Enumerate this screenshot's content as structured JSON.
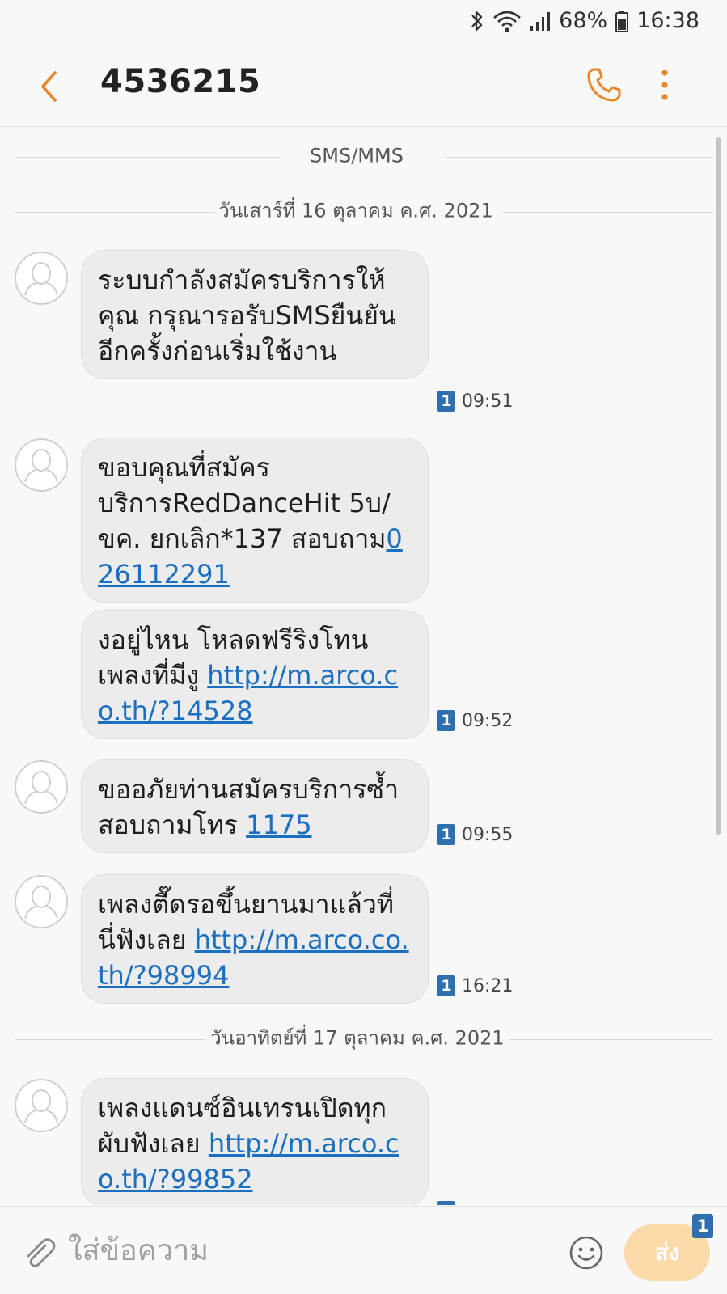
{
  "status_bar": {
    "battery": "68%",
    "time": "16:38",
    "icons": [
      "bluetooth-icon",
      "wifi-icon",
      "signal-icon",
      "battery-icon"
    ]
  },
  "header": {
    "title": "4536215",
    "back_icon": "chevron-left-icon",
    "call_icon": "phone-icon",
    "more_icon": "more-vertical-icon",
    "accent_color": "#e8862a"
  },
  "conversation": {
    "channel_label": "SMS/MMS",
    "date_1": "วันเสาร์ที่ 16 ตุลาคม ค.ศ. 2021",
    "date_2": "วันอาทิตย์ที่ 17 ตุลาคม ค.ศ. 2021",
    "messages": [
      {
        "text": "ระบบกำลังสมัครบริการให้คุณ กรุณารอรับSMSยืนยันอีกครั้งก่อนเริ่มใช้งาน",
        "sim": "1",
        "time": "09:51"
      },
      {
        "text": "ขอบคุณที่สมัครบริการRedDanceHit 5บ/ขค. ยกเลิก*137 สอบถาม",
        "link": "026112291"
      },
      {
        "text": "งอยู่ไหน โหลดฟรีริงโทนเพลงที่มีงู ",
        "link": "http://m.arco.co.th/?14528",
        "sim": "1",
        "time": "09:52"
      },
      {
        "text": "ขออภัยท่านสมัครบริการซ้ำ สอบถามโทร ",
        "link": "1175",
        "sim": "1",
        "time": "09:55"
      },
      {
        "text": "เพลงตื๊ดรอขึ้นยานมาแล้วที่นี่ฟังเลย ",
        "link": "http://m.arco.co.th/?98994",
        "sim": "1",
        "time": "16:21"
      },
      {
        "text": "เพลงแดนซ์อินเทรนเปิดทุกผับฟังเลย ",
        "link": "http://m.arco.co.th/?99852"
      }
    ]
  },
  "composer": {
    "placeholder": "ใส่ข้อความ",
    "send_label": "ส่ง",
    "send_sim": "1",
    "attach_icon": "paperclip-icon",
    "emoji_icon": "smiley-icon"
  }
}
